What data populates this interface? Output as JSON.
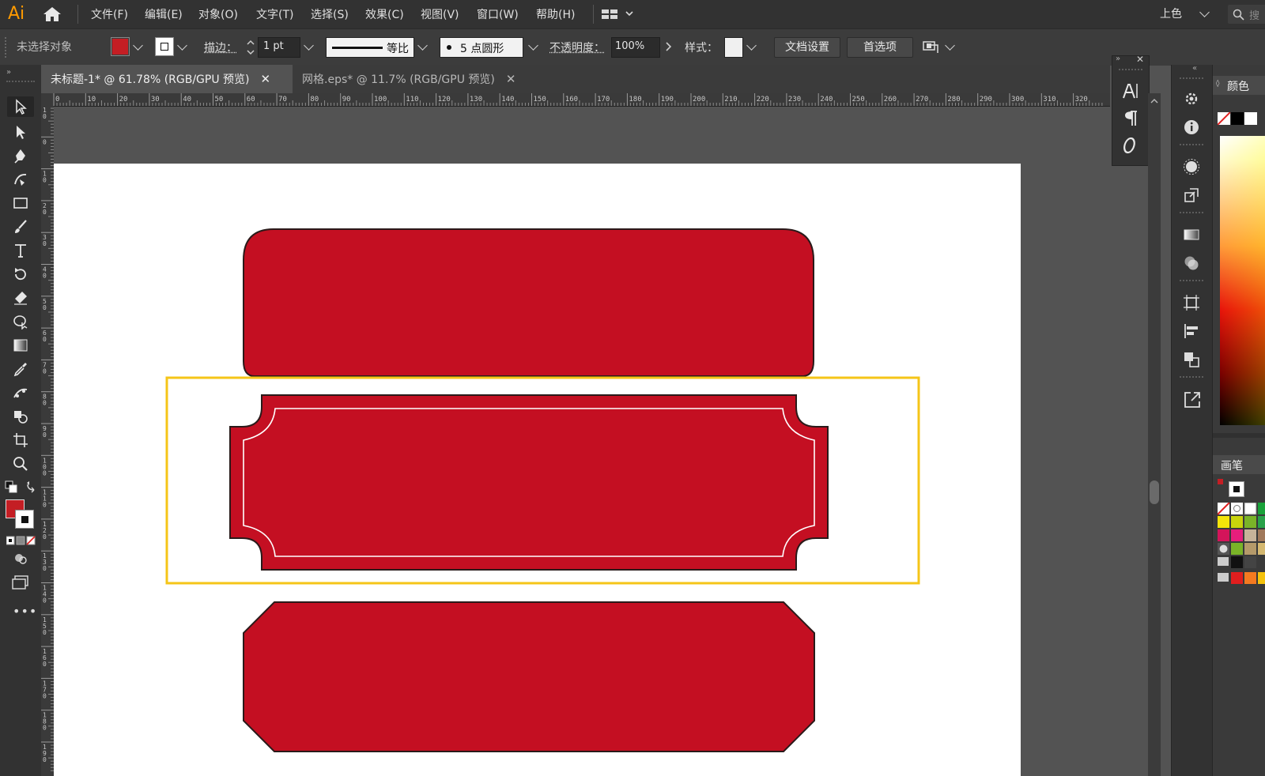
{
  "app": {
    "logo": "Ai"
  },
  "menu": {
    "items": [
      "文件(F)",
      "编辑(E)",
      "对象(O)",
      "文字(T)",
      "选择(S)",
      "效果(C)",
      "视图(V)",
      "窗口(W)",
      "帮助(H)"
    ],
    "workspace": "上色",
    "search_placeholder": "搜"
  },
  "control": {
    "selection": "未选择对象",
    "fill_color": "#c41e24",
    "stroke_label": "描边：",
    "stroke_weight": "1 pt",
    "stroke_profile": "等比",
    "brush": "5 点圆形",
    "opacity_label": "不透明度：",
    "opacity_value": "100%",
    "style_label": "样式：",
    "doc_setup": "文档设置",
    "preferences": "首选项"
  },
  "tabs": [
    {
      "label": "未标题-1* @ 61.78% (RGB/GPU 预览)",
      "active": true
    },
    {
      "label": "网格.eps* @ 11.7% (RGB/GPU 预览)",
      "active": false
    }
  ],
  "ruler": {
    "marks": [
      "0",
      "10",
      "20",
      "30",
      "40",
      "50",
      "60",
      "70",
      "80",
      "90",
      "100",
      "110",
      "120",
      "130",
      "140",
      "150",
      "160",
      "170",
      "180",
      "190",
      "200",
      "210",
      "220",
      "230",
      "240",
      "250",
      "260",
      "270",
      "280",
      "290",
      "300",
      "310",
      "320"
    ],
    "left_marks": [
      "1\n0",
      "0",
      "1\n0",
      "2\n0",
      "3\n0",
      "4\n0",
      "5\n0",
      "6\n0",
      "7\n0",
      "8\n0",
      "9\n0",
      "1\n0\n0",
      "1\n1\n0",
      "1\n2\n0",
      "1\n3\n0",
      "1\n4\n0",
      "1\n5\n0",
      "1\n6\n0",
      "1\n7\n0",
      "1\n8\n0",
      "1\n9\n0"
    ]
  },
  "artwork": {
    "fill": "#c40f22",
    "stroke": "#2a1a1a",
    "selection_color": "#f5c518"
  },
  "panels": {
    "color_label": "颜色",
    "brush_label": "画笔"
  }
}
